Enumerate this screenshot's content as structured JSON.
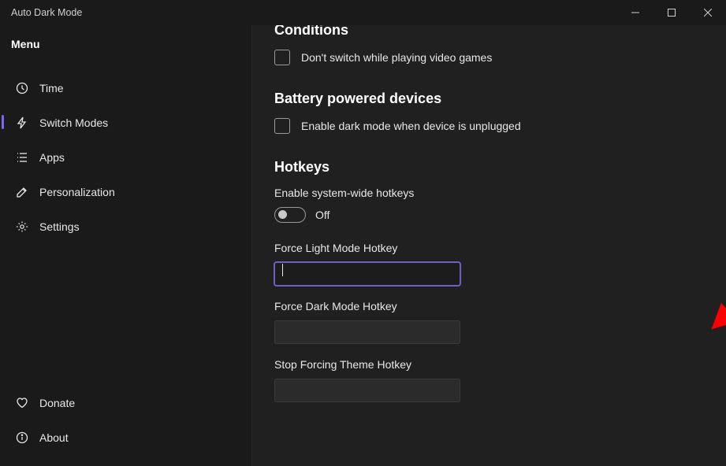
{
  "window": {
    "title": "Auto Dark Mode"
  },
  "sidebar": {
    "heading": "Menu",
    "items": [
      {
        "label": "Time"
      },
      {
        "label": "Switch Modes"
      },
      {
        "label": "Apps"
      },
      {
        "label": "Personalization"
      },
      {
        "label": "Settings"
      }
    ],
    "footer": [
      {
        "label": "Donate"
      },
      {
        "label": "About"
      }
    ],
    "activeIndex": 1
  },
  "main": {
    "conditions": {
      "heading": "Conditions",
      "checkbox1": "Don't switch while playing video games"
    },
    "battery": {
      "heading": "Battery powered devices",
      "checkbox1": "Enable dark mode when device is unplugged"
    },
    "hotkeys": {
      "heading": "Hotkeys",
      "enableLabel": "Enable system-wide hotkeys",
      "toggleState": "Off",
      "fields": [
        {
          "label": "Force Light Mode Hotkey",
          "value": ""
        },
        {
          "label": "Force Dark Mode Hotkey",
          "value": ""
        },
        {
          "label": "Stop Forcing Theme Hotkey",
          "value": ""
        }
      ],
      "focusedField": 0
    }
  }
}
